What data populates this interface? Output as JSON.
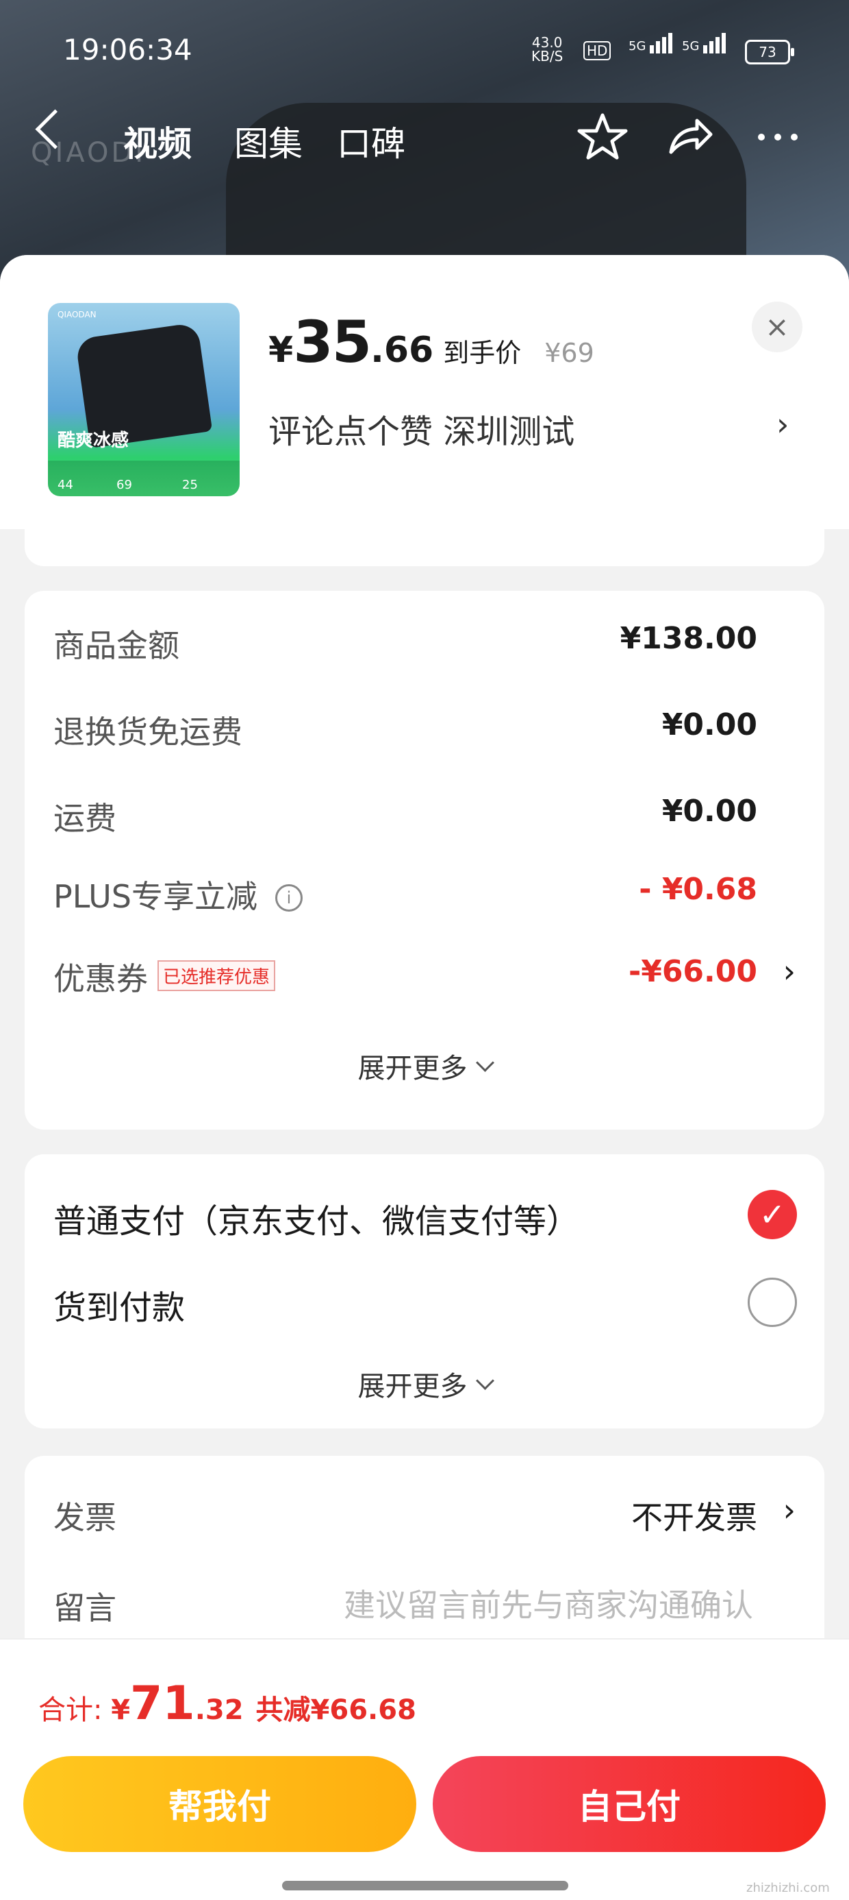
{
  "status_bar": {
    "time": "19:06:34",
    "net_speed": "43.0",
    "net_unit": "KB/S",
    "hd": "HD",
    "sig1": "5G",
    "sig2": "5G",
    "battery": "73"
  },
  "nav": {
    "tabs": [
      "视频",
      "图集",
      "口碑"
    ],
    "active_tab": "视频",
    "icons": [
      "back-icon",
      "star-icon",
      "share-icon",
      "more-icon"
    ]
  },
  "product": {
    "price_yen": "¥",
    "price_int": "35",
    "price_dec": ".66",
    "price_tag": "到手价",
    "orig_price": "¥69",
    "subtitle": "评论点个赞  深圳测试",
    "thumb": {
      "slogan": "酷爽冰感",
      "left_price": "44",
      "mid_price": "69",
      "right_price": "25"
    }
  },
  "order_summary": {
    "rows": [
      {
        "label": "商品金额",
        "value": "¥138.00"
      },
      {
        "label": "退换货免运费",
        "value": "¥0.00"
      },
      {
        "label": "运费",
        "value": "¥0.00"
      },
      {
        "label": "PLUS专享立减",
        "value": "- ¥0.68"
      },
      {
        "label": "优惠券",
        "value": "-¥66.00",
        "badge": "已选推荐优惠"
      }
    ],
    "expand_label": "展开更多"
  },
  "payment": {
    "options": [
      {
        "label": "普通支付（京东支付、微信支付等）",
        "selected": true
      },
      {
        "label": "货到付款",
        "selected": false
      }
    ],
    "expand_label": "展开更多"
  },
  "extras": {
    "invoice_label": "发票",
    "invoice_value": "不开发票",
    "message_label": "留言",
    "message_placeholder": "建议留言前先与商家沟通确认"
  },
  "footer": {
    "total_label": "合计: ",
    "total_yen": "¥",
    "total_int": "71",
    "total_dec": ".32",
    "savings": "共减¥66.68",
    "help_pay": "帮我付",
    "self_pay": "自己付",
    "watermark": "zhizhizhi.com"
  },
  "colors": {
    "accent_red": "#e62d28",
    "yellow_button": "#ffbb17",
    "red_button": "#f5271e"
  }
}
